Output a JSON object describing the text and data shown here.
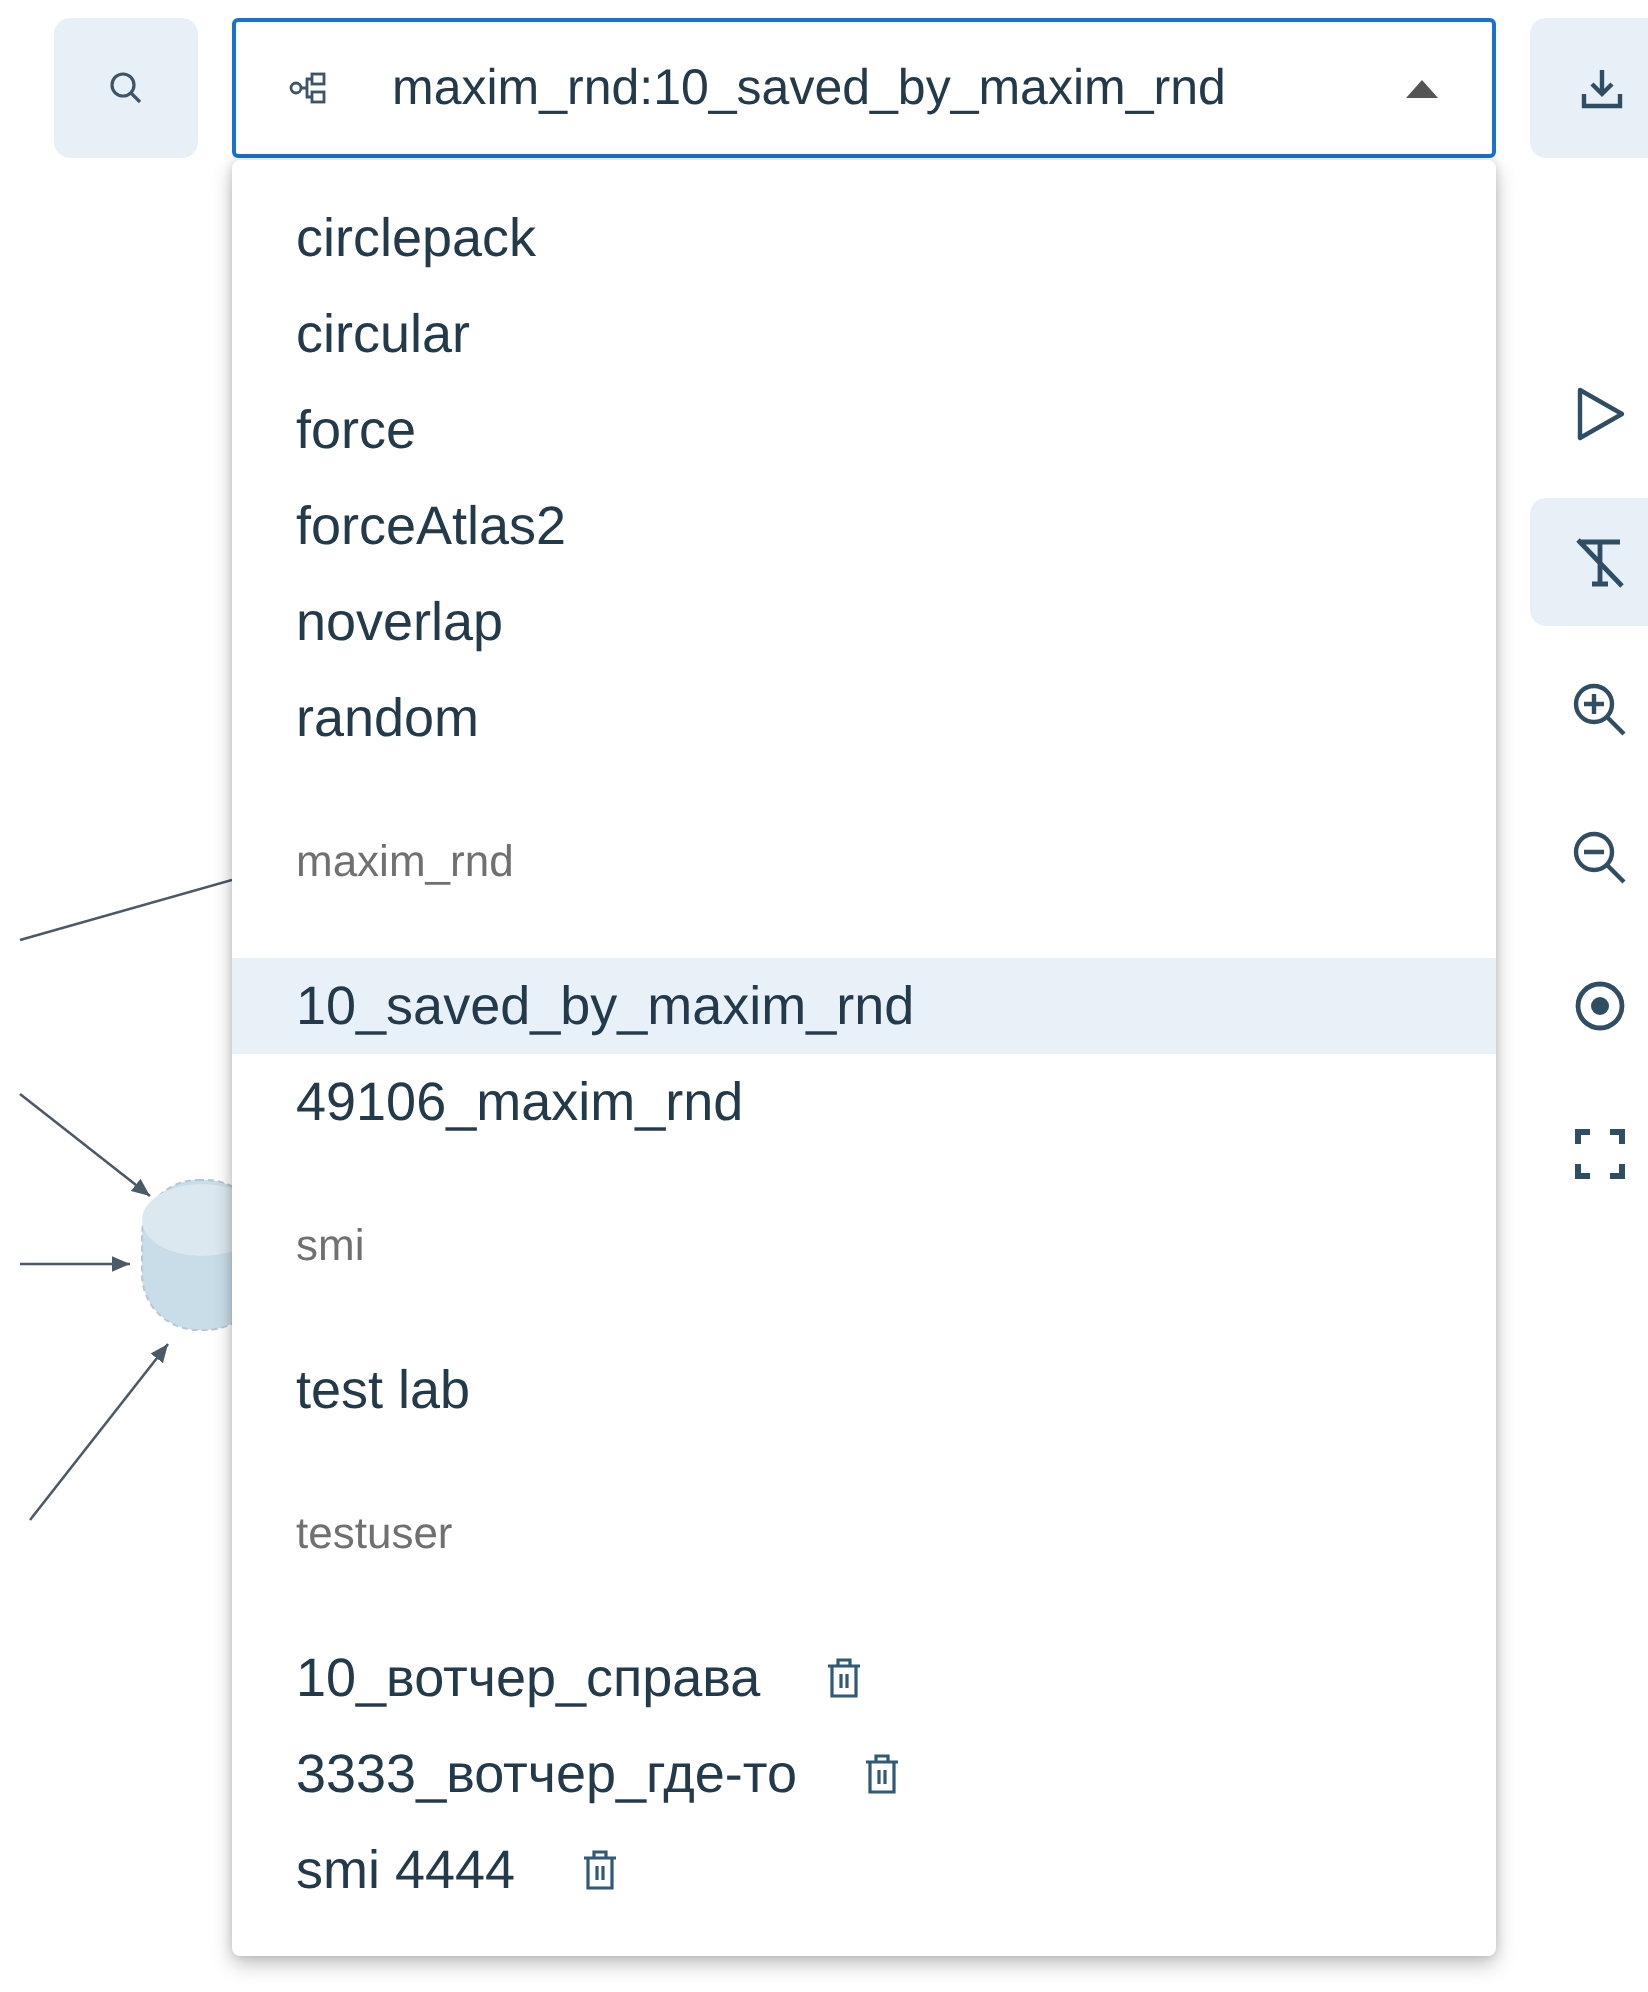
{
  "search_button": {
    "active": false
  },
  "layout_select": {
    "value": "maxim_rnd:10_saved_by_maxim_rnd",
    "expanded": true
  },
  "dropdown": {
    "groups": [
      {
        "items": [
          {
            "label": "circlepack",
            "selected": false,
            "deletable": false
          },
          {
            "label": "circular",
            "selected": false,
            "deletable": false
          },
          {
            "label": "force",
            "selected": false,
            "deletable": false
          },
          {
            "label": "forceAtlas2",
            "selected": false,
            "deletable": false
          },
          {
            "label": "noverlap",
            "selected": false,
            "deletable": false
          },
          {
            "label": "random",
            "selected": false,
            "deletable": false
          }
        ]
      },
      {
        "header": "maxim_rnd",
        "items": [
          {
            "label": "10_saved_by_maxim_rnd",
            "selected": true,
            "deletable": false
          },
          {
            "label": "49106_maxim_rnd",
            "selected": false,
            "deletable": false
          }
        ]
      },
      {
        "header": "smi",
        "items": [
          {
            "label": "test lab",
            "selected": false,
            "deletable": false
          }
        ]
      },
      {
        "header": "testuser",
        "items": [
          {
            "label": "10_вотчер_справа",
            "selected": false,
            "deletable": true
          },
          {
            "label": "3333_вотчер_где-то",
            "selected": false,
            "deletable": true
          },
          {
            "label": "smi 4444",
            "selected": false,
            "deletable": true
          }
        ]
      }
    ]
  },
  "side_toolbar": [
    {
      "kind": "play",
      "active": false
    },
    {
      "kind": "text-off",
      "active": true
    },
    {
      "kind": "zoom-in",
      "active": false
    },
    {
      "kind": "zoom-out",
      "active": false
    },
    {
      "kind": "center",
      "active": false
    },
    {
      "kind": "fullscreen",
      "active": false
    }
  ]
}
